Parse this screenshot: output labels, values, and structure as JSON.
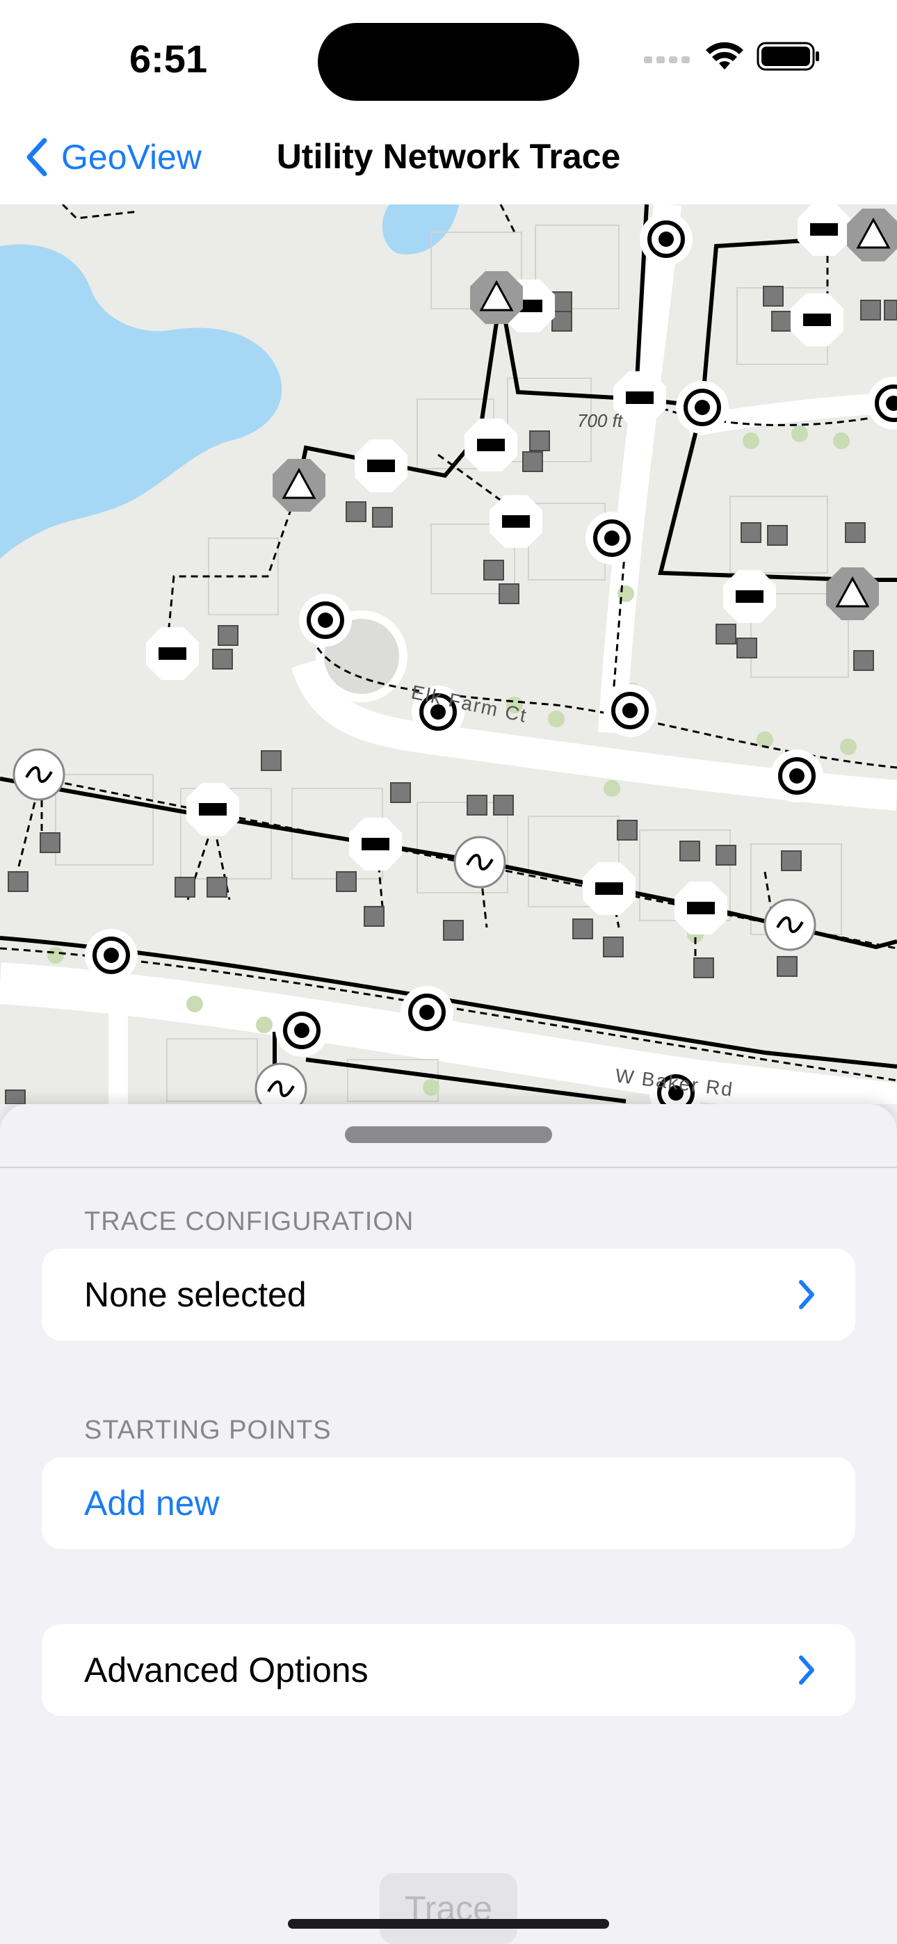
{
  "status": {
    "time": "6:51"
  },
  "nav": {
    "back_label": "GeoView",
    "title": "Utility Network Trace"
  },
  "map": {
    "scale_label": "700 ft",
    "street_1": "Elk Farm Ct",
    "street_2": "W Baker Rd"
  },
  "sheet": {
    "trace_config_header": "TRACE CONFIGURATION",
    "trace_config_value": "None selected",
    "starting_points_header": "STARTING POINTS",
    "add_new_label": "Add new",
    "advanced_options_label": "Advanced Options",
    "trace_button_label": "Trace"
  },
  "colors": {
    "accent": "#1a7cf5",
    "water": "#a6d8f5",
    "map_bg": "#ebebe7"
  }
}
